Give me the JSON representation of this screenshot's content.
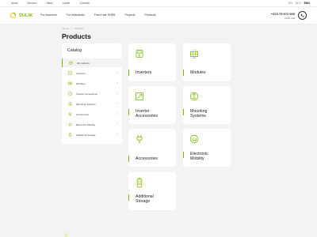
{
  "topbar": {
    "links": [
      "About",
      "Services",
      "News",
      "Career",
      "Contacts"
    ],
    "langs": [
      "EN",
      "SLO",
      "ENG"
    ],
    "active_lang": "ENG"
  },
  "header": {
    "logo_text": "SULIK",
    "nav": [
      "For business",
      "For individuals",
      "Fixed rate SHEB",
      "Projects",
      "Products"
    ],
    "phone": "+373 79 072 000",
    "order_label": "Order call"
  },
  "breadcrumb": [
    "Home",
    "/",
    "Products"
  ],
  "page_title": "Products",
  "catalog": {
    "title": "Catalog",
    "items": [
      {
        "label": "All products",
        "icon": "grid-icon"
      },
      {
        "label": "Inverters",
        "icon": "inverter-icon"
      },
      {
        "label": "Modules",
        "icon": "module-icon"
      },
      {
        "label": "Inverter Accessories",
        "icon": "accessory-icon"
      },
      {
        "label": "Mounting Systems",
        "icon": "mounting-icon"
      },
      {
        "label": "Accessories",
        "icon": "plug-icon"
      },
      {
        "label": "Electronic Mobility",
        "icon": "ev-icon"
      },
      {
        "label": "Additional Storage",
        "icon": "battery-icon"
      }
    ]
  },
  "cards": [
    {
      "label": "Inverters",
      "icon": "inverter-icon"
    },
    {
      "label": "Modules",
      "icon": "solar-panel-icon"
    },
    {
      "label": "Inverter\nAccessories",
      "icon": "inverter-accessory-icon"
    },
    {
      "label": "Mounting\nSystems",
      "icon": "mounting-icon"
    },
    {
      "label": "Accessories",
      "icon": "plug-icon"
    },
    {
      "label": "Electronic\nMobility",
      "icon": "ev-charger-icon"
    },
    {
      "label": "Additional\nStorage",
      "icon": "battery-icon"
    }
  ],
  "colors": {
    "accent": "#7ab800",
    "background": "#f3f3f3",
    "card": "#ffffff"
  }
}
